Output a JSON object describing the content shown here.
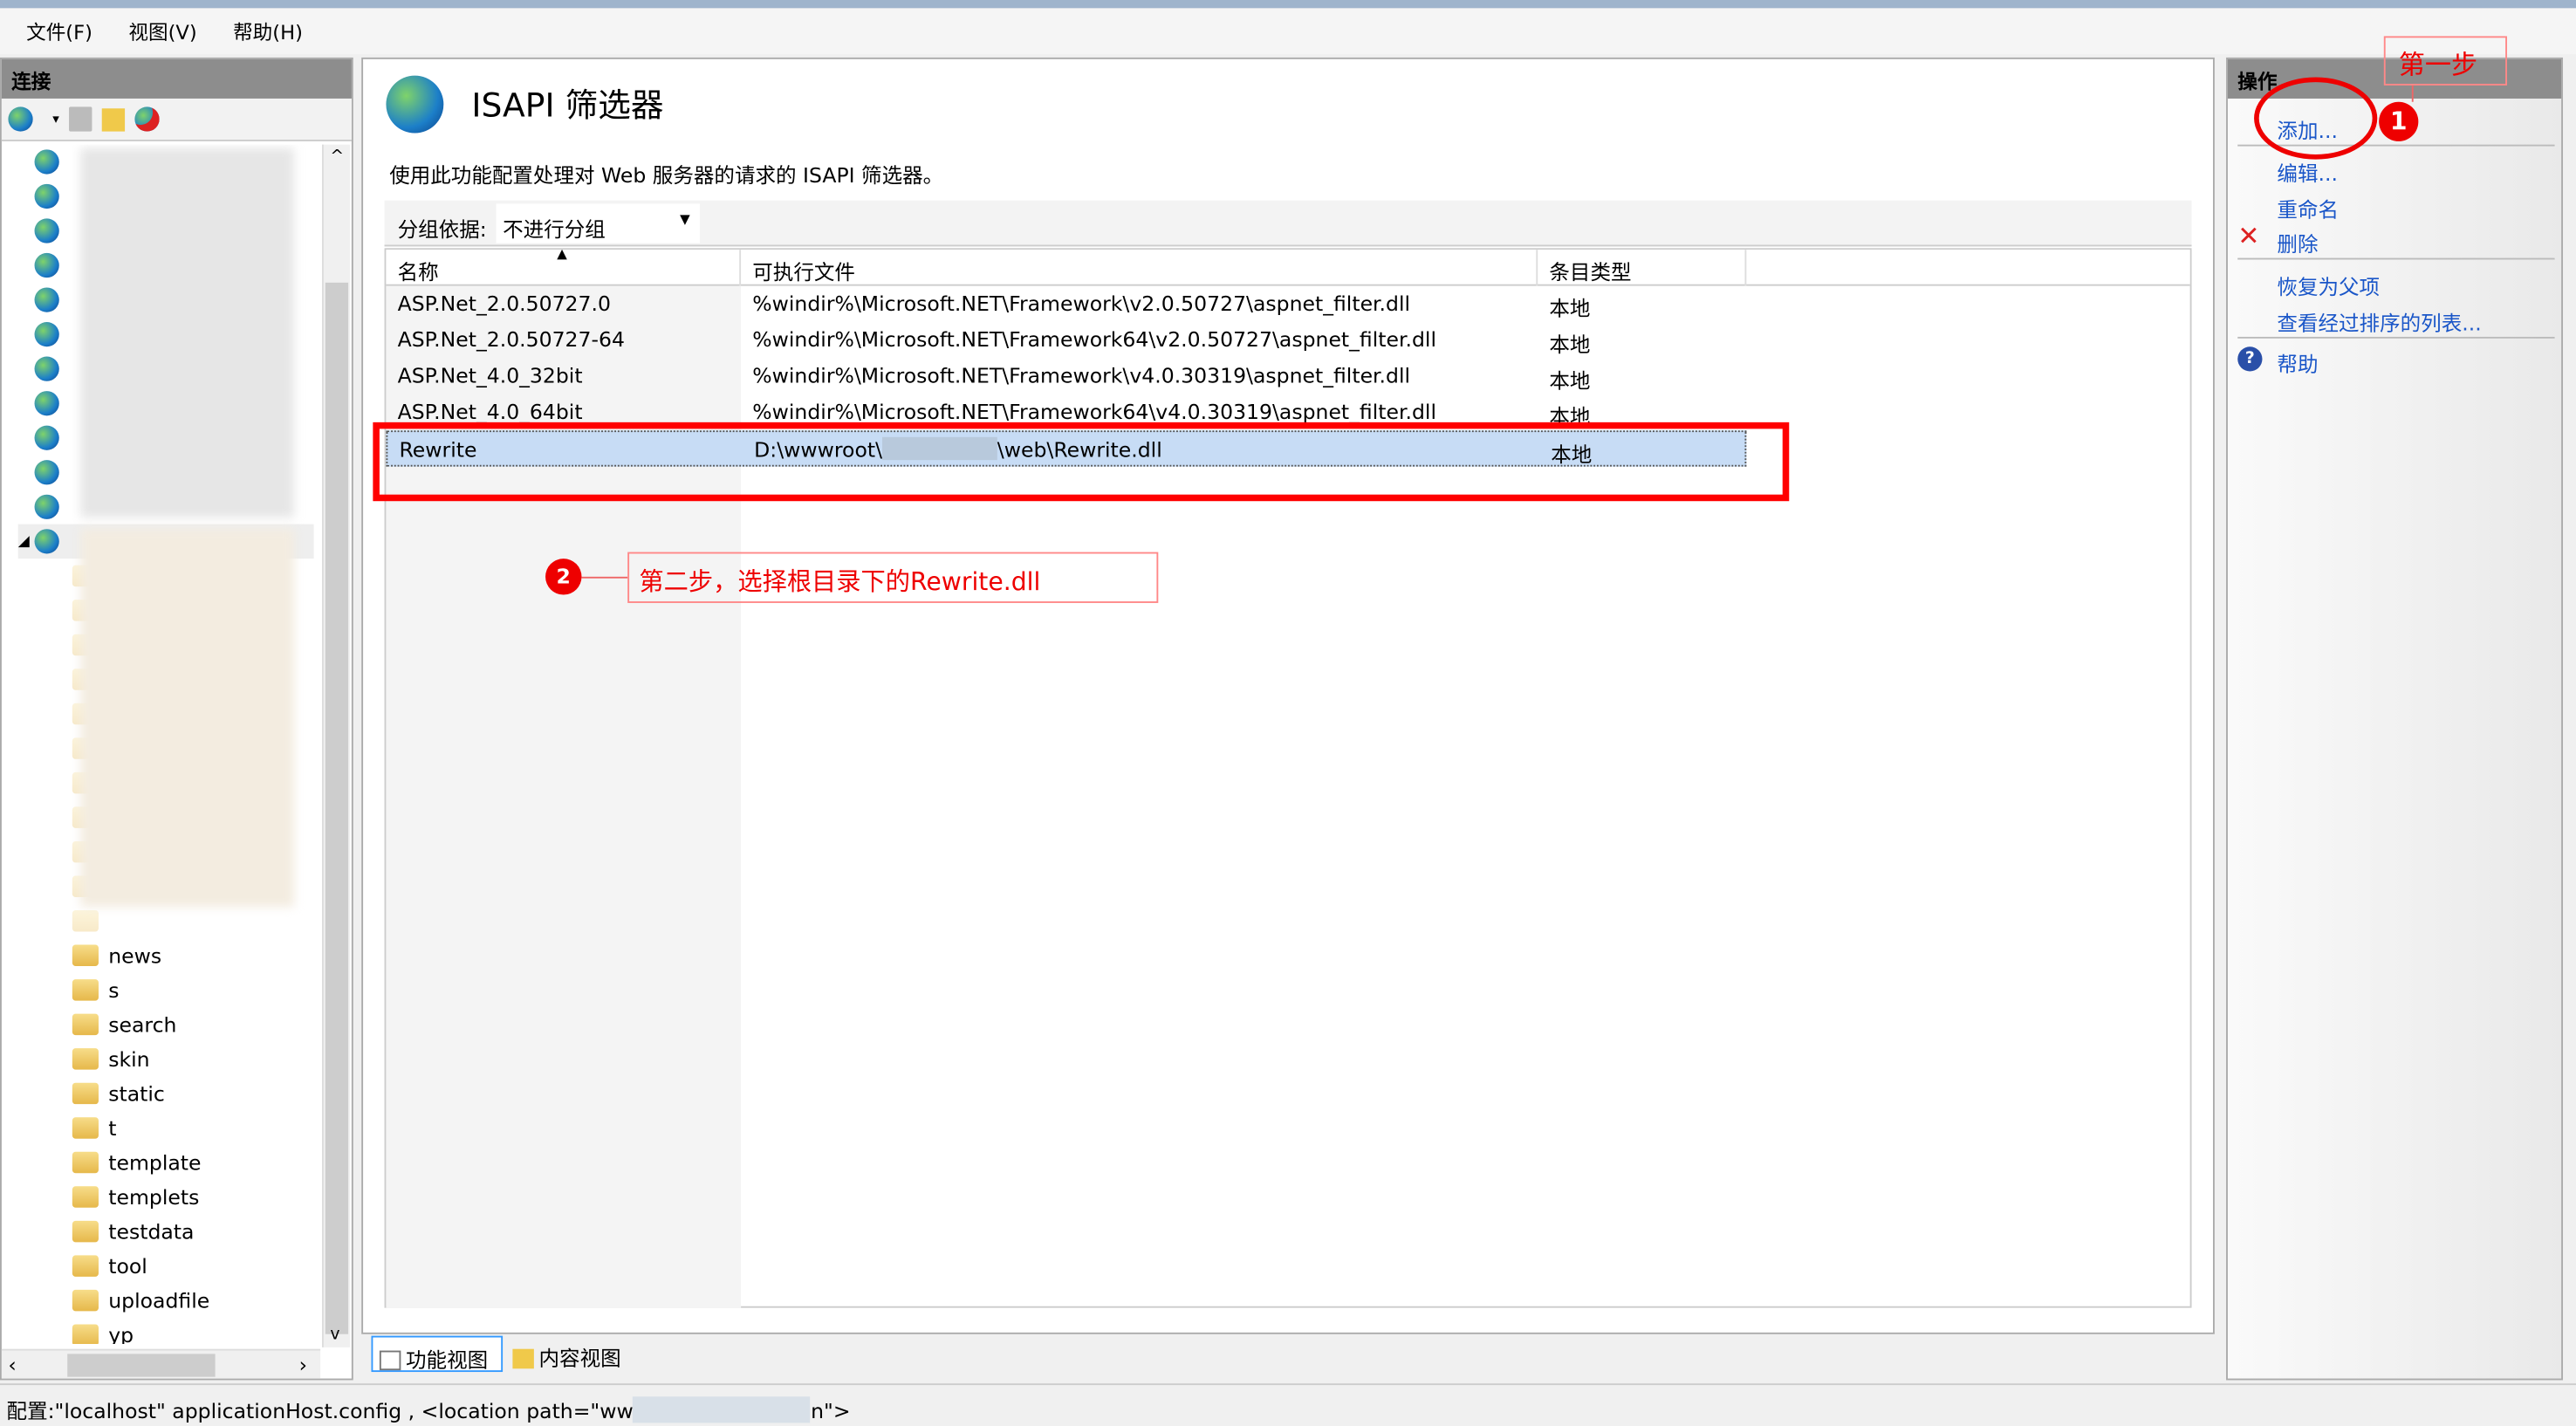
{
  "menu": [
    "文件(F)",
    "视图(V)",
    "帮助(H)"
  ],
  "connections": {
    "title": "连接",
    "folders": [
      "news",
      "s",
      "search",
      "skin",
      "static",
      "t",
      "template",
      "templets",
      "testdata",
      "tool",
      "uploadfile",
      "yp"
    ]
  },
  "main": {
    "title": "ISAPI 筛选器",
    "description": "使用此功能配置处理对 Web 服务器的请求的 ISAPI 筛选器。",
    "group_label": "分组依据:",
    "group_value": "不进行分组",
    "columns": [
      "名称",
      "可执行文件",
      "条目类型"
    ],
    "rows": [
      {
        "name": "ASP.Net_2.0.50727.0",
        "path": "%windir%\\Microsoft.NET\\Framework\\v2.0.50727\\aspnet_filter.dll",
        "type": "本地"
      },
      {
        "name": "ASP.Net_2.0.50727-64",
        "path": "%windir%\\Microsoft.NET\\Framework64\\v2.0.50727\\aspnet_filter.dll",
        "type": "本地"
      },
      {
        "name": "ASP.Net_4.0_32bit",
        "path": "%windir%\\Microsoft.NET\\Framework\\v4.0.30319\\aspnet_filter.dll",
        "type": "本地"
      },
      {
        "name": "ASP.Net_4.0_64bit",
        "path": "%windir%\\Microsoft.NET\\Framework64\\v4.0.30319\\aspnet_filter.dll",
        "type": "本地"
      },
      {
        "name": "Rewrite",
        "path_prefix": "D:\\wwwroot\\",
        "path_suffix": "\\web\\Rewrite.dll",
        "type": "本地"
      }
    ],
    "tabs": [
      "功能视图",
      "内容视图"
    ]
  },
  "actions": {
    "title": "操作",
    "items": [
      "添加...",
      "编辑...",
      "重命名",
      "删除",
      "恢复为父项",
      "查看经过排序的列表...",
      "帮助"
    ]
  },
  "annotations": {
    "step1": "第一步",
    "badge1": "1",
    "step2": "第二步，选择根目录下的Rewrite.dll",
    "badge2": "2",
    "color": "#ff0000"
  },
  "status": {
    "prefix": "配置:\"localhost\" applicationHost.config , <location path=\"ww",
    "suffix": "n\">"
  }
}
